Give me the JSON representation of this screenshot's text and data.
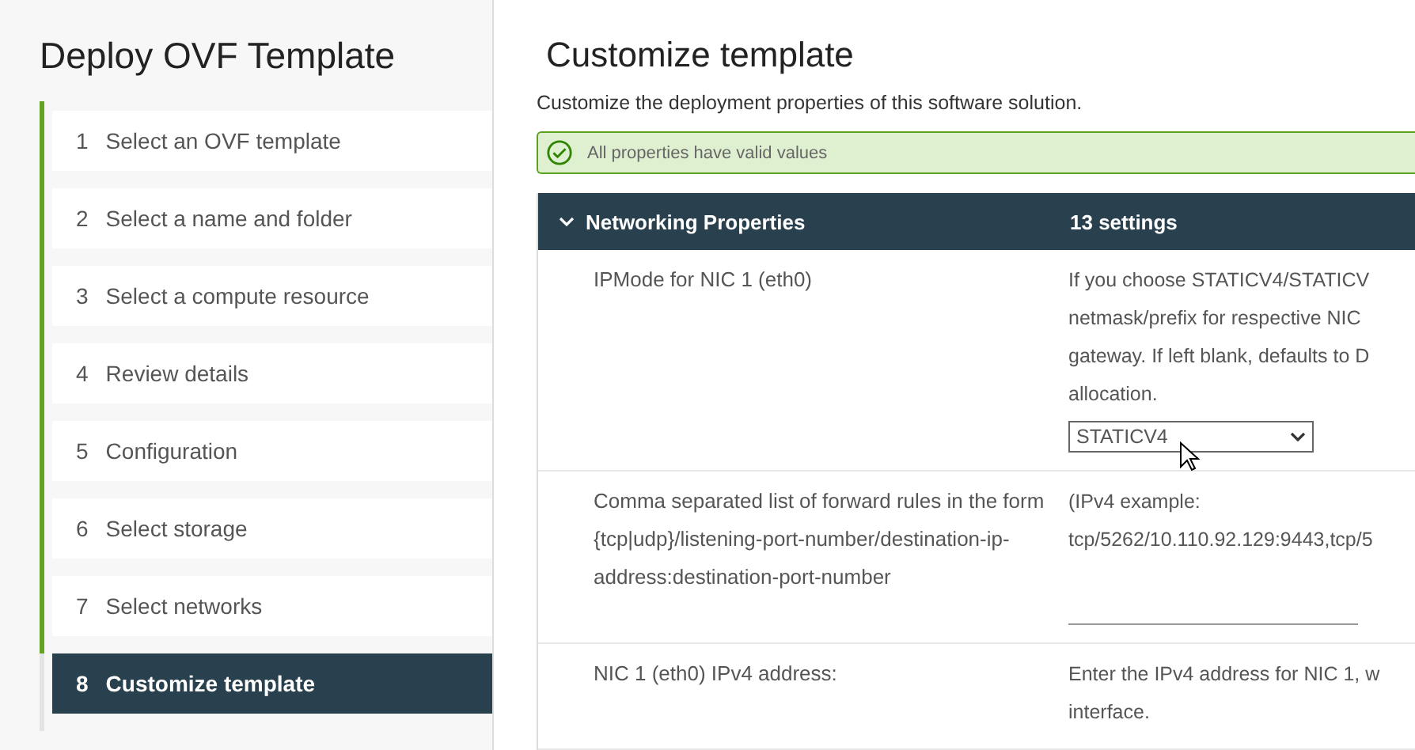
{
  "sidebar": {
    "title": "Deploy OVF Template",
    "steps": [
      {
        "number": "1",
        "label": "Select an OVF template",
        "completed": true,
        "selected": false
      },
      {
        "number": "2",
        "label": "Select a name and folder",
        "completed": true,
        "selected": false
      },
      {
        "number": "3",
        "label": "Select a compute resource",
        "completed": true,
        "selected": false
      },
      {
        "number": "4",
        "label": "Review details",
        "completed": true,
        "selected": false
      },
      {
        "number": "5",
        "label": "Configuration",
        "completed": true,
        "selected": false
      },
      {
        "number": "6",
        "label": "Select storage",
        "completed": true,
        "selected": false
      },
      {
        "number": "7",
        "label": "Select networks",
        "completed": true,
        "selected": false
      },
      {
        "number": "8",
        "label": "Customize template",
        "completed": false,
        "selected": true
      }
    ]
  },
  "main": {
    "title": "Customize template",
    "subtitle": "Customize the deployment properties of this software solution.",
    "alert": {
      "kind": "success",
      "text": "All properties have valid values"
    },
    "section": {
      "title": "Networking Properties",
      "count": "13 settings",
      "expanded": true
    },
    "properties": [
      {
        "label": "IPMode for NIC 1 (eth0)",
        "description_lines": [
          "If you choose STATICV4/STATICV",
          "netmask/prefix for respective NIC",
          "gateway. If left blank, defaults to D",
          "allocation."
        ],
        "control": {
          "kind": "select",
          "value": "STATICV4"
        }
      },
      {
        "label": "Comma separated list of forward rules in the form {tcp|udp}/listening-port-number/destination-ip-address:destination-port-number",
        "description_lines": [
          "(IPv4 example:",
          "tcp/5262/10.110.92.129:9443,tcp/5"
        ],
        "control": {
          "kind": "text"
        }
      },
      {
        "label": "NIC 1 (eth0) IPv4 address:",
        "description_lines": [
          "Enter the IPv4 address for NIC 1, w",
          "interface."
        ]
      }
    ]
  }
}
